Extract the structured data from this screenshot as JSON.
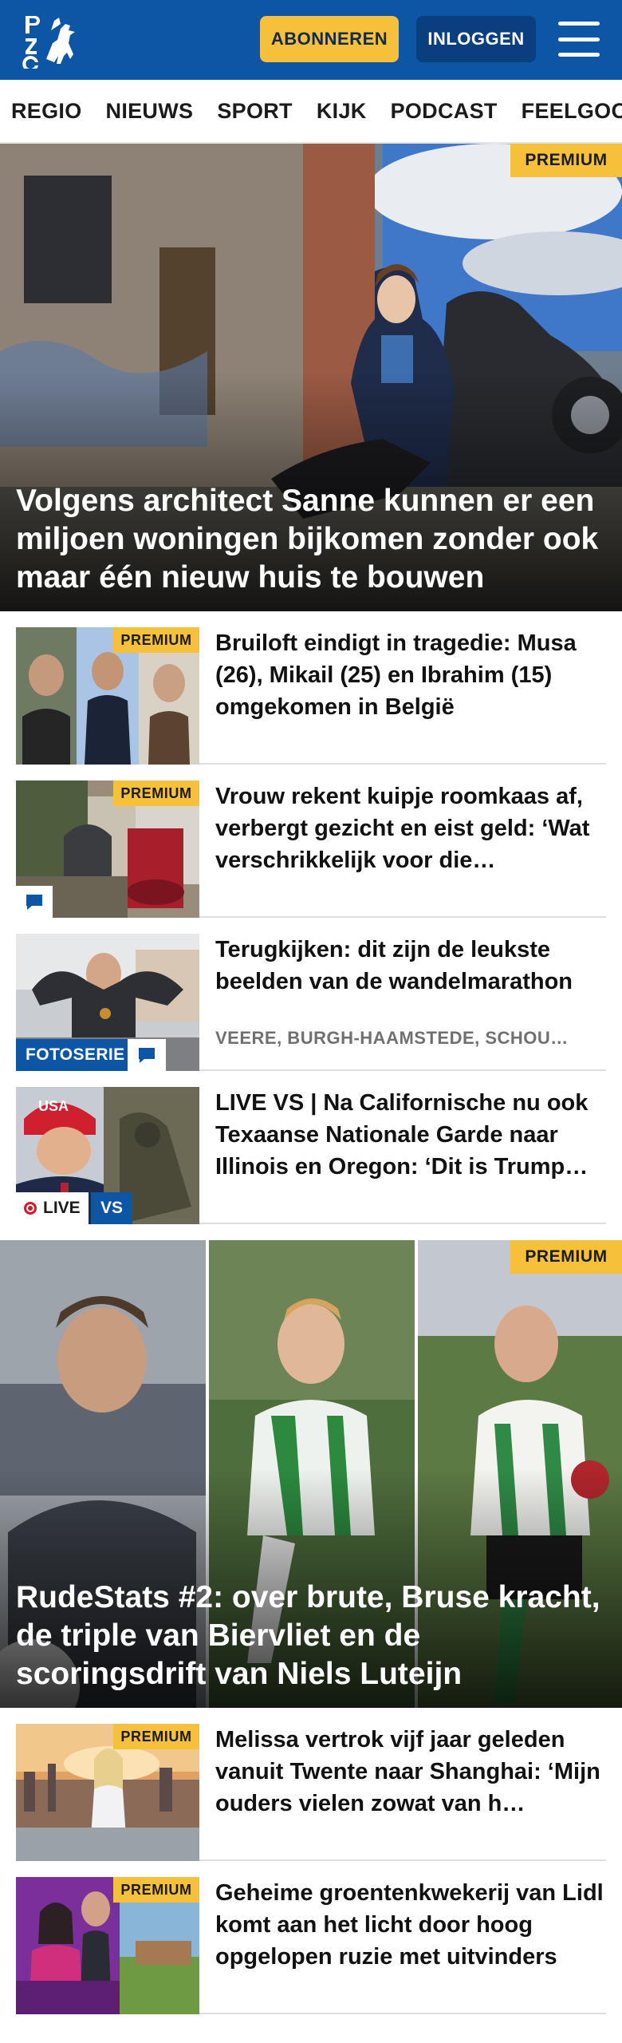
{
  "header": {
    "logo_text": "PZC",
    "subscribe_label": "ABONNEREN",
    "login_label": "INLOGGEN",
    "menu_icon": "hamburger-menu-icon",
    "brand_color": "#0d56a6",
    "accent_color": "#f7c03b"
  },
  "nav": {
    "items": [
      "REGIO",
      "NIEUWS",
      "SPORT",
      "KIJK",
      "PODCAST",
      "FEELGOOD"
    ]
  },
  "hero1": {
    "badge": "PREMIUM",
    "title": "Volgens architect Sanne kunnen er een miljoen woningen bijkomen zonder ook maar één nieuw huis te bouwen"
  },
  "list1": [
    {
      "badge": "PREMIUM",
      "title": "Bruiloft eindigt in tragedie: Musa (26), Mikail (25) en Ibrahim (15) omgekomen in België"
    },
    {
      "badge": "PREMIUM",
      "title": "Vrouw rekent kuipje roomkaas af, verbergt gezicht en eist geld: ‘Wat verschrikkelijk voor die…",
      "comment_icon": "comment-icon"
    },
    {
      "title": "Terugkijken: dit zijn de leukste beelden van de wandelmarathon",
      "label": "FOTOSERIE",
      "meta": "VEERE, BURGH-HAAMSTEDE, SCHOU…",
      "comment_icon": "comment-icon"
    },
    {
      "title": "LIVE VS | Na Californische nu ook Texaanse Nationale Garde naar Illinois en Oregon: ‘Dit is Trump…",
      "live_label": "LIVE",
      "vs_label": "VS",
      "cap_text": "USA"
    }
  ],
  "hero2": {
    "badge": "PREMIUM",
    "title": "RudeStats #2: over brute, Bruse kracht, de triple van Biervliet en de scoringsdrift van Niels Luteijn"
  },
  "list2": [
    {
      "badge": "PREMIUM",
      "title": "Melissa vertrok vijf jaar geleden vanuit Twente naar Shanghai: ‘Mijn ouders vielen zowat van h…"
    },
    {
      "badge": "PREMIUM",
      "title": "Geheime groentenkwekerij van Lidl komt aan het licht door hoog opgelopen ruzie met uitvinders"
    }
  ]
}
